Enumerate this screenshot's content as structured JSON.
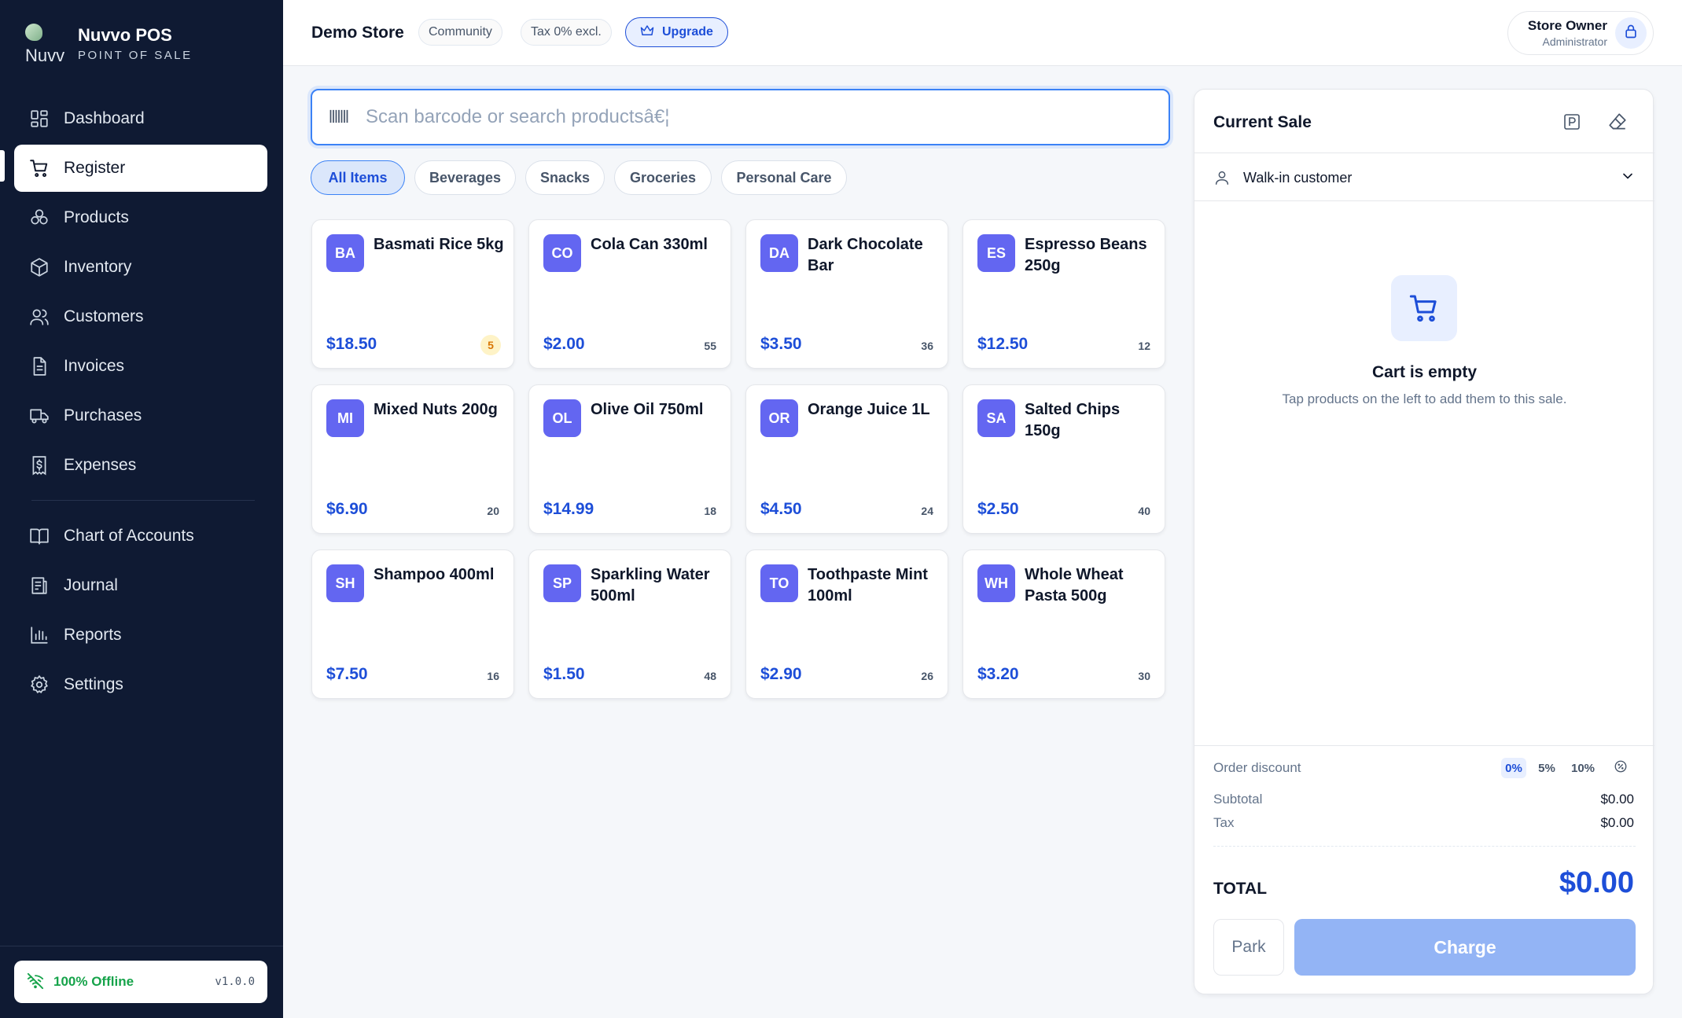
{
  "brand": {
    "name": "Nuvvo POS",
    "subtitle": "POINT OF SALE",
    "logo_text": "Nuvv"
  },
  "nav": {
    "primary": [
      {
        "label": "Dashboard",
        "icon": "dashboard-icon"
      },
      {
        "label": "Register",
        "icon": "cart-icon",
        "active": true
      },
      {
        "label": "Products",
        "icon": "products-icon"
      },
      {
        "label": "Inventory",
        "icon": "box-icon"
      },
      {
        "label": "Customers",
        "icon": "users-icon"
      },
      {
        "label": "Invoices",
        "icon": "file-icon"
      },
      {
        "label": "Purchases",
        "icon": "truck-icon"
      },
      {
        "label": "Expenses",
        "icon": "receipt-dollar-icon"
      }
    ],
    "secondary": [
      {
        "label": "Chart of Accounts",
        "icon": "book-icon"
      },
      {
        "label": "Journal",
        "icon": "journal-icon"
      },
      {
        "label": "Reports",
        "icon": "bar-chart-icon"
      },
      {
        "label": "Settings",
        "icon": "gear-icon"
      }
    ]
  },
  "footer": {
    "status": "100% Offline",
    "version": "v1.0.0",
    "status_color": "#16a34a"
  },
  "topbar": {
    "store_name": "Demo Store",
    "plan": "Community",
    "tax": "Tax 0% excl.",
    "upgrade": "Upgrade",
    "user_name": "Store Owner",
    "user_role": "Administrator"
  },
  "search": {
    "placeholder": "Scan barcode or search productsâ€¦",
    "value": ""
  },
  "categories": [
    "All Items",
    "Beverages",
    "Snacks",
    "Groceries",
    "Personal Care"
  ],
  "active_category": "All Items",
  "products": [
    {
      "initials": "BA",
      "name": "Basmati Rice 5kg",
      "price": "$18.50",
      "stock": "5",
      "low_stock": true
    },
    {
      "initials": "CO",
      "name": "Cola Can 330ml",
      "price": "$2.00",
      "stock": "55"
    },
    {
      "initials": "DA",
      "name": "Dark Chocolate Bar",
      "price": "$3.50",
      "stock": "36"
    },
    {
      "initials": "ES",
      "name": "Espresso Beans 250g",
      "price": "$12.50",
      "stock": "12"
    },
    {
      "initials": "MI",
      "name": "Mixed Nuts 200g",
      "price": "$6.90",
      "stock": "20"
    },
    {
      "initials": "OL",
      "name": "Olive Oil 750ml",
      "price": "$14.99",
      "stock": "18"
    },
    {
      "initials": "OR",
      "name": "Orange Juice 1L",
      "price": "$4.50",
      "stock": "24"
    },
    {
      "initials": "SA",
      "name": "Salted Chips 150g",
      "price": "$2.50",
      "stock": "40"
    },
    {
      "initials": "SH",
      "name": "Shampoo 400ml",
      "price": "$7.50",
      "stock": "16"
    },
    {
      "initials": "SP",
      "name": "Sparkling Water 500ml",
      "price": "$1.50",
      "stock": "48"
    },
    {
      "initials": "TO",
      "name": "Toothpaste Mint 100ml",
      "price": "$2.90",
      "stock": "26"
    },
    {
      "initials": "WH",
      "name": "Whole Wheat Pasta 500g",
      "price": "$3.20",
      "stock": "30"
    }
  ],
  "cart": {
    "title": "Current Sale",
    "customer": "Walk-in customer",
    "empty_title": "Cart is empty",
    "empty_subtitle": "Tap products on the left to add them to this sale.",
    "discount_label": "Order discount",
    "discount_options": [
      "0%",
      "5%",
      "10%"
    ],
    "active_discount": "0%",
    "subtotal_label": "Subtotal",
    "subtotal": "$0.00",
    "tax_label": "Tax",
    "tax": "$0.00",
    "total_label": "TOTAL",
    "total": "$0.00",
    "park_label": "Park",
    "charge_label": "Charge"
  },
  "colors": {
    "sidebar": "#0f1a33",
    "accent": "#1d4ed8",
    "badge": "#6366f1",
    "low_stock": "#d97706"
  }
}
